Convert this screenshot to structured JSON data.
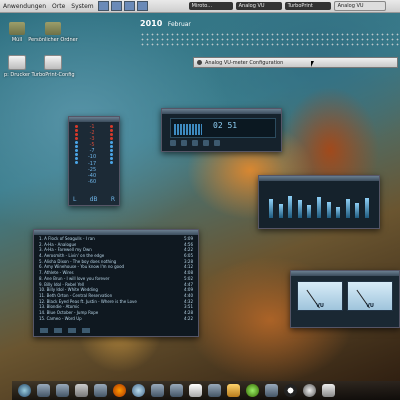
{
  "top_panel": {
    "menus": [
      "Anwendungen",
      "Orte",
      "System"
    ],
    "tasks": [
      {
        "label": "Miroto..."
      },
      {
        "label": "Analog VU"
      },
      {
        "label": "TurboPrint"
      },
      {
        "label": "Analog VU",
        "active": true
      }
    ]
  },
  "desktop_icons": [
    {
      "label": "Müll"
    },
    {
      "label": "Persönlicher Ordner"
    },
    {
      "label": "p: Drucker"
    },
    {
      "label": "TurboPrint-Config"
    }
  ],
  "calendar": {
    "year": "2010",
    "month": "Februar"
  },
  "config_bar": {
    "title": "Analog VU-meter Configuration"
  },
  "vu_meter": {
    "scale": [
      "-1",
      "-2",
      "-3",
      "-5",
      "-7",
      "-10",
      "-17",
      "-25",
      "-40",
      "-60"
    ],
    "left_label": "L",
    "db_label": "dB",
    "right_label": "R"
  },
  "player": {
    "time": "02 51"
  },
  "playlist": {
    "rows": [
      {
        "title": "1. A Flock of Seagulls - I ran",
        "time": "5:09"
      },
      {
        "title": "2. A-Ha - Analogue",
        "time": "4:56"
      },
      {
        "title": "3. A-Ha - Farewell my Own",
        "time": "4:22"
      },
      {
        "title": "4. Aerosmith - Livin' on the edge",
        "time": "6:05"
      },
      {
        "title": "5. Alisha Dixon - The boy does nothing",
        "time": "3:28"
      },
      {
        "title": "6. Amy Winehouse - You know I'm no good",
        "time": "4:12"
      },
      {
        "title": "7. Athlete - Wires",
        "time": "4:08"
      },
      {
        "title": "8. Ane Brun - I will love you forever",
        "time": "5:02"
      },
      {
        "title": "9. Billy Idol - Rebel Yell",
        "time": "4:47"
      },
      {
        "title": "10. Billy Idol - White Wedding",
        "time": "4:09"
      },
      {
        "title": "11. Beth Orton - Central Reservation",
        "time": "4:40"
      },
      {
        "title": "12. Black Eyed Peas ft. Justin - Where is the Love",
        "time": "4:32"
      },
      {
        "title": "13. Blondie - Atomic",
        "time": "3:51"
      },
      {
        "title": "14. Blue October - Jump Rope",
        "time": "4:28"
      },
      {
        "title": "15. Cameo - Word Up",
        "time": "4:22"
      }
    ]
  },
  "analog_vu": {
    "left_label": "VU",
    "right_label": "VU"
  },
  "colors": {
    "led_red": "#d83a2a",
    "led_blue": "#4aa6e8",
    "accent": "#8fd0f6"
  }
}
